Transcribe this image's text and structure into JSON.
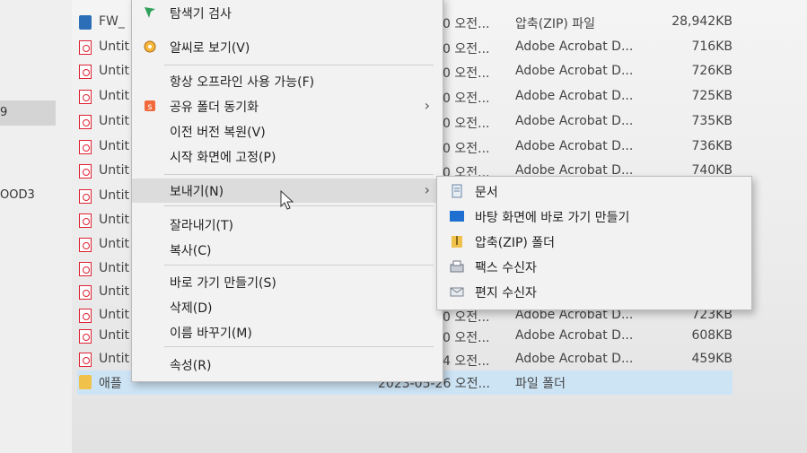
{
  "nav": {
    "items": [
      {
        "label": "9"
      },
      {
        "label": "OOD3"
      }
    ]
  },
  "files": [
    {
      "name": "FW_",
      "type": "압축(ZIP) 파일",
      "size": "28,942KB",
      "date": "0 오전...",
      "icon": "zip-icon"
    },
    {
      "name": "Untit",
      "type": "Adobe Acrobat D...",
      "size": "716KB",
      "date": "0 오전...",
      "icon": "pdf-icon"
    },
    {
      "name": "Untit",
      "type": "Adobe Acrobat D...",
      "size": "726KB",
      "date": "0 오전...",
      "icon": "pdf-icon"
    },
    {
      "name": "Untit",
      "type": "Adobe Acrobat D...",
      "size": "725KB",
      "date": "0 오전...",
      "icon": "pdf-icon"
    },
    {
      "name": "Untit",
      "type": "Adobe Acrobat D...",
      "size": "735KB",
      "date": "0 오전...",
      "icon": "pdf-icon"
    },
    {
      "name": "Untit",
      "type": "Adobe Acrobat D...",
      "size": "736KB",
      "date": "0 오전...",
      "icon": "pdf-icon"
    },
    {
      "name": "Untit",
      "type": "Adobe Acrobat D...",
      "size": "740KB",
      "date": "0 오전...",
      "icon": "pdf-icon"
    },
    {
      "name": "Untit",
      "type": "",
      "size": "",
      "date": "",
      "icon": "pdf-icon"
    },
    {
      "name": "Untit",
      "type": "",
      "size": "",
      "date": "",
      "icon": "pdf-icon"
    },
    {
      "name": "Untit",
      "type": "",
      "size": "",
      "date": "",
      "icon": "pdf-icon"
    },
    {
      "name": "Untit",
      "type": "",
      "size": "",
      "date": "",
      "icon": "pdf-icon"
    },
    {
      "name": "Untit",
      "type": "",
      "size": "",
      "date": "",
      "icon": "pdf-icon"
    },
    {
      "name": "Untit",
      "type": "Adobe Acrobat D...",
      "size": "723KB",
      "date": "0 오전...",
      "icon": "pdf-icon"
    },
    {
      "name": "Untit",
      "type": "Adobe Acrobat D...",
      "size": "608KB",
      "date": "0 오전...",
      "icon": "pdf-icon"
    },
    {
      "name": "Untit",
      "type": "Adobe Acrobat D...",
      "size": "459KB",
      "date": "4 오전...",
      "icon": "pdf-icon"
    },
    {
      "name": "애플",
      "type": "파일 폴더",
      "size": "",
      "date": "2023-05-26 오전...",
      "icon": "folder-icon"
    }
  ],
  "menu": {
    "items": [
      {
        "label": "탐색기 검사",
        "icon": "scan-icon"
      },
      {
        "label": "알씨로 보기(V)",
        "icon": "alsee-icon"
      },
      {
        "label": "항상 오프라인 사용 가능(F)"
      },
      {
        "label": "공유 폴더 동기화",
        "icon": "sync-icon"
      },
      {
        "label": "이전 버전 복원(V)"
      },
      {
        "label": "시작 화면에 고정(P)"
      },
      {
        "label": "보내기(N)"
      },
      {
        "label": "잘라내기(T)"
      },
      {
        "label": "복사(C)"
      },
      {
        "label": "바로 가기 만들기(S)"
      },
      {
        "label": "삭제(D)"
      },
      {
        "label": "이름 바꾸기(M)"
      },
      {
        "label": "속성(R)"
      }
    ],
    "arrow": "›"
  },
  "submenu": {
    "items": [
      {
        "label": "문서",
        "icon": "document-icon"
      },
      {
        "label": "바탕 화면에 바로 가기 만들기",
        "icon": "desktop-icon"
      },
      {
        "label": "압축(ZIP) 폴더",
        "icon": "zip-folder-icon"
      },
      {
        "label": "팩스 수신자",
        "icon": "fax-icon"
      },
      {
        "label": "편지 수신자",
        "icon": "mail-icon"
      }
    ]
  },
  "colors": {
    "selection": "#cde4f5",
    "menu_bg": "#f2f2f2",
    "hover": "#dcdcdc",
    "pdf_red": "#dd2233",
    "desktop_blue": "#1e6fd0"
  }
}
